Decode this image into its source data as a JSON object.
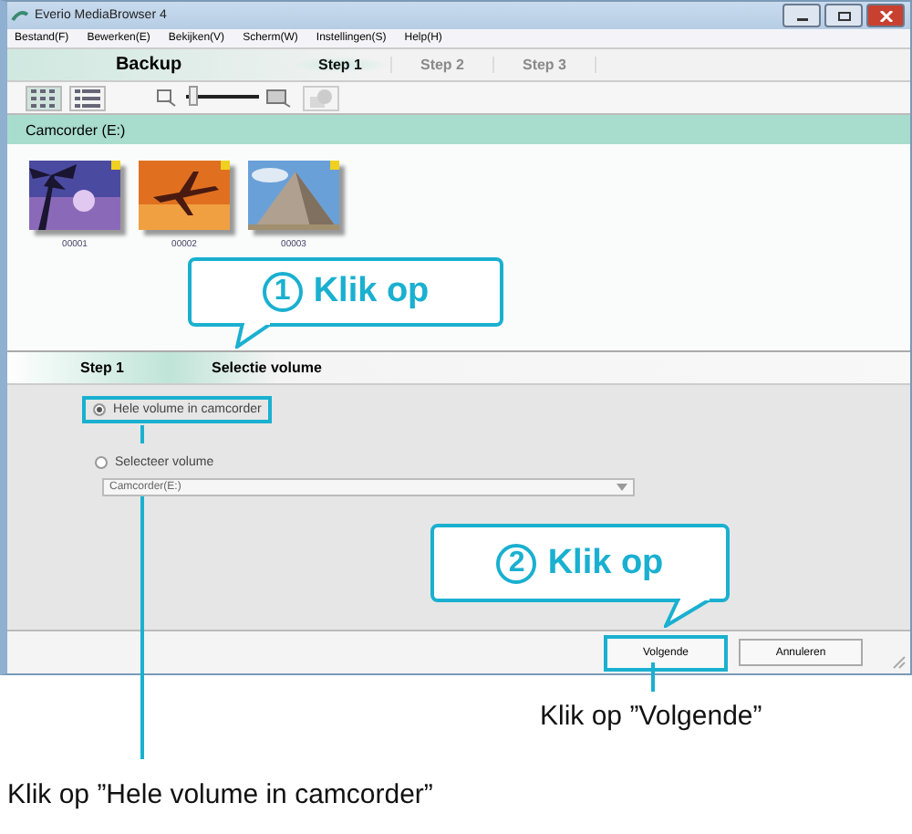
{
  "window": {
    "title": "Everio MediaBrowser 4"
  },
  "menu": [
    "Bestand(F)",
    "Bewerken(E)",
    "Bekijken(V)",
    "Scherm(W)",
    "Instellingen(S)",
    "Help(H)"
  ],
  "mode": "Backup",
  "steps": [
    {
      "label": "Step 1",
      "selected": true
    },
    {
      "label": "Step 2",
      "selected": false
    },
    {
      "label": "Step 3",
      "selected": false
    }
  ],
  "toolbar": {
    "views": [
      {
        "kind": "grid",
        "selected": true
      },
      {
        "kind": "list",
        "selected": false
      }
    ],
    "zoom": {
      "level": 0.1
    }
  },
  "source": {
    "title": "Camcorder (E:)",
    "items": [
      {
        "label": "00001",
        "kind": "palm"
      },
      {
        "label": "00002",
        "kind": "plane"
      },
      {
        "label": "00003",
        "kind": "pyramid"
      }
    ]
  },
  "step_header": {
    "step": "Step 1",
    "title": "Selectie volume"
  },
  "options": [
    {
      "label": "Hele volume in camcorder",
      "selected": true
    },
    {
      "label": "Selecteer volume",
      "selected": false
    }
  ],
  "volume_dropdown": {
    "value": "Camcorder(E:)"
  },
  "buttons": [
    {
      "label": "Volgende",
      "kind": "primary"
    },
    {
      "label": "Annuleren",
      "kind": "normal"
    }
  ],
  "callouts": [
    {
      "number": "1",
      "text": "Klik op"
    },
    {
      "number": "2",
      "text": "Klik op"
    }
  ],
  "notes": [
    "Klik op ”Volgende”",
    "Klik op ”Hele volume in camcorder”"
  ]
}
